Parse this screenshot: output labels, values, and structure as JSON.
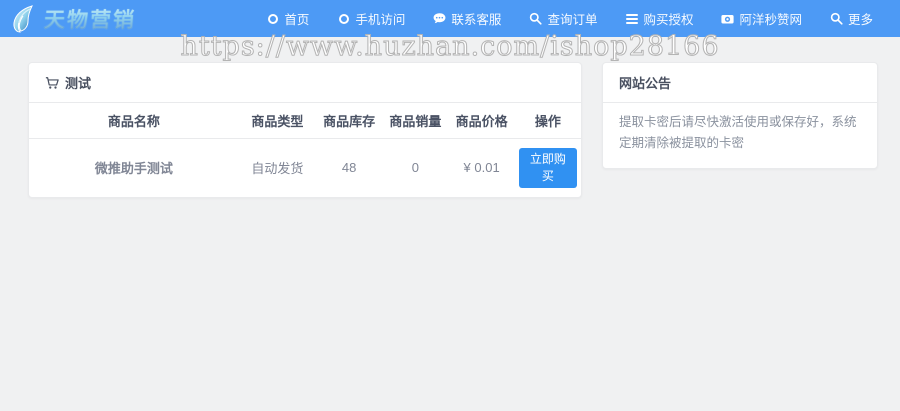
{
  "nav": {
    "logo_text": "天物营销",
    "items": [
      {
        "label": "首页",
        "icon": "circle-icon"
      },
      {
        "label": "手机访问",
        "icon": "circle-icon"
      },
      {
        "label": "联系客服",
        "icon": "comment-icon"
      },
      {
        "label": "查询订单",
        "icon": "search-icon"
      },
      {
        "label": "购买授权",
        "icon": "list-icon"
      },
      {
        "label": "阿洋秒赞网",
        "icon": "camera-icon"
      },
      {
        "label": "更多",
        "icon": "search-icon"
      }
    ]
  },
  "watermark": {
    "text": "https://www.huzhan.com/ishop28166"
  },
  "product_card": {
    "title": "测试",
    "table": {
      "headers": [
        "商品名称",
        "商品类型",
        "商品库存",
        "商品销量",
        "商品价格",
        "操作"
      ],
      "rows": [
        {
          "name": "微推助手测试",
          "type": "自动发货",
          "stock": "48",
          "sales": "0",
          "price": "¥ 0.01",
          "action": "立即购买"
        }
      ]
    }
  },
  "announcement_card": {
    "title": "网站公告",
    "body": "提取卡密后请尽快激活使用或保存好，系统定期清除被提取的卡密"
  },
  "colors": {
    "nav_blue": "#4d9af5",
    "accent_blue": "#2d8cf0",
    "page_bg": "#f0f1f2"
  }
}
